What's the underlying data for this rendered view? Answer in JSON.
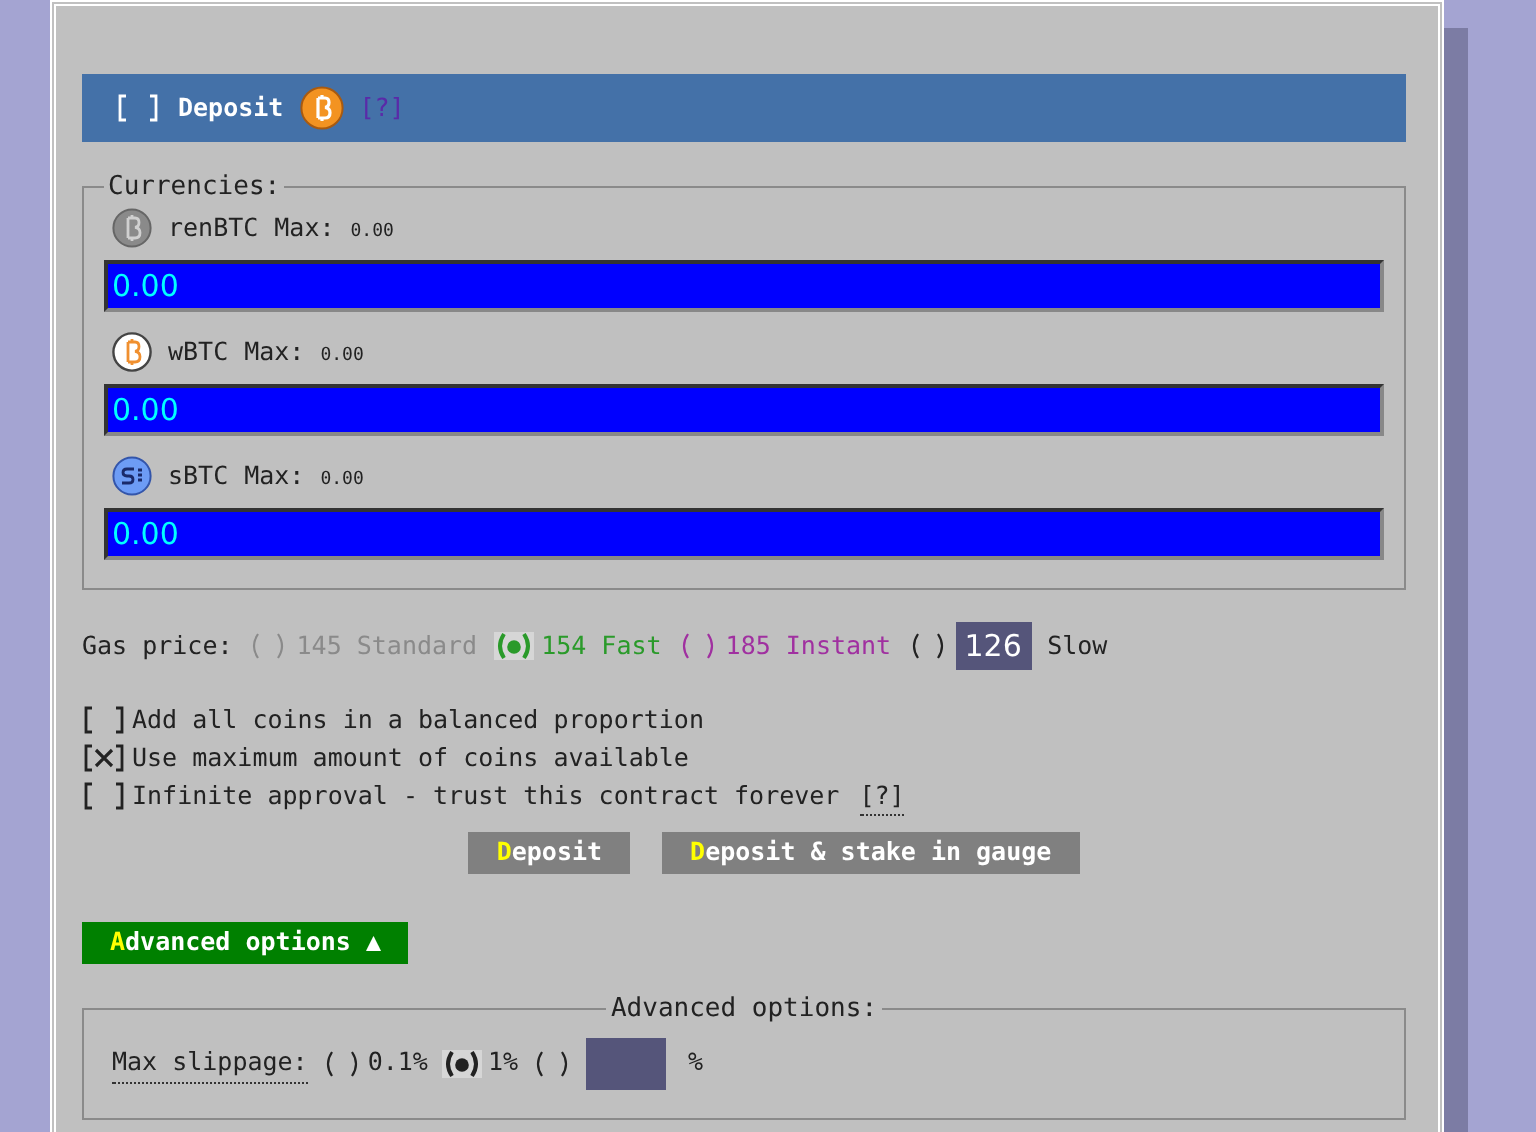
{
  "header": {
    "checkbox": {
      "checked": false
    },
    "title": "Deposit",
    "help": "[?]"
  },
  "currencies": {
    "legend": "Currencies:",
    "coins": [
      {
        "kind": "ren",
        "name": "renBTC",
        "max_label": "Max:",
        "max": "0.00",
        "value": "0.00"
      },
      {
        "kind": "wrapped",
        "name": "wBTC",
        "max_label": "Max:",
        "max": "0.00",
        "value": "0.00"
      },
      {
        "kind": "synth",
        "name": "sBTC",
        "max_label": "Max:",
        "max": "0.00",
        "value": "0.00"
      }
    ]
  },
  "gas": {
    "label": "Gas price:",
    "options": [
      {
        "value": "145",
        "name": "Standard",
        "color": "#8a8a8a",
        "selected": false
      },
      {
        "value": "154",
        "name": "Fast",
        "color": "#2a9a2a",
        "selected": true
      },
      {
        "value": "185",
        "name": "Instant",
        "color": "#a030a0",
        "selected": false
      }
    ],
    "custom": {
      "selected": false,
      "value": "126",
      "name": "Slow"
    }
  },
  "options": [
    {
      "label": "Add all coins in a balanced proportion",
      "checked": false
    },
    {
      "label": "Use maximum amount of coins available",
      "checked": true
    },
    {
      "label": "Infinite approval - trust this contract forever",
      "checked": false,
      "help": "[?]"
    }
  ],
  "buttons": [
    "Deposit",
    "Deposit & stake in gauge"
  ],
  "advanced_toggle": {
    "label": "Advanced options ▲",
    "expanded": true
  },
  "advanced": {
    "legend": "Advanced options:",
    "slippage": {
      "label": "Max slippage:",
      "options": [
        {
          "value": "0.1%",
          "selected": false
        },
        {
          "value": "1%",
          "selected": true
        }
      ],
      "custom": {
        "selected": false,
        "unit": "%"
      }
    }
  }
}
